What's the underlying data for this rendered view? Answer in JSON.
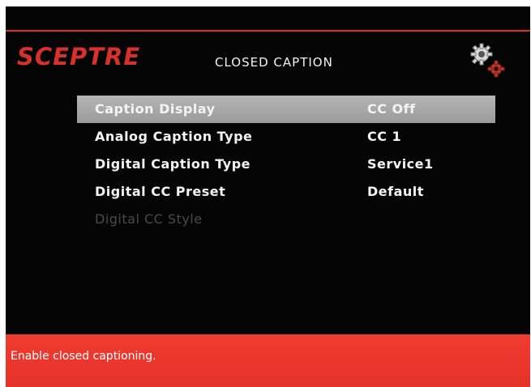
{
  "brand": {
    "logo_text": "SCEPTRE",
    "logo_color": "#d8302a"
  },
  "header": {
    "title": "CLOSED CAPTION",
    "settings_icon": "gears-icon"
  },
  "menu": {
    "items": [
      {
        "label": "Caption Display",
        "value": "CC Off",
        "state": "selected"
      },
      {
        "label": "Analog Caption Type",
        "value": "CC 1",
        "state": "normal"
      },
      {
        "label": "Digital Caption Type",
        "value": "Service1",
        "state": "normal"
      },
      {
        "label": "Digital CC Preset",
        "value": "Default",
        "state": "normal"
      },
      {
        "label": "Digital CC Style",
        "value": "",
        "state": "disabled"
      }
    ]
  },
  "help": {
    "text": "Enable closed captioning.",
    "bar_color": "#ec3a2f"
  }
}
